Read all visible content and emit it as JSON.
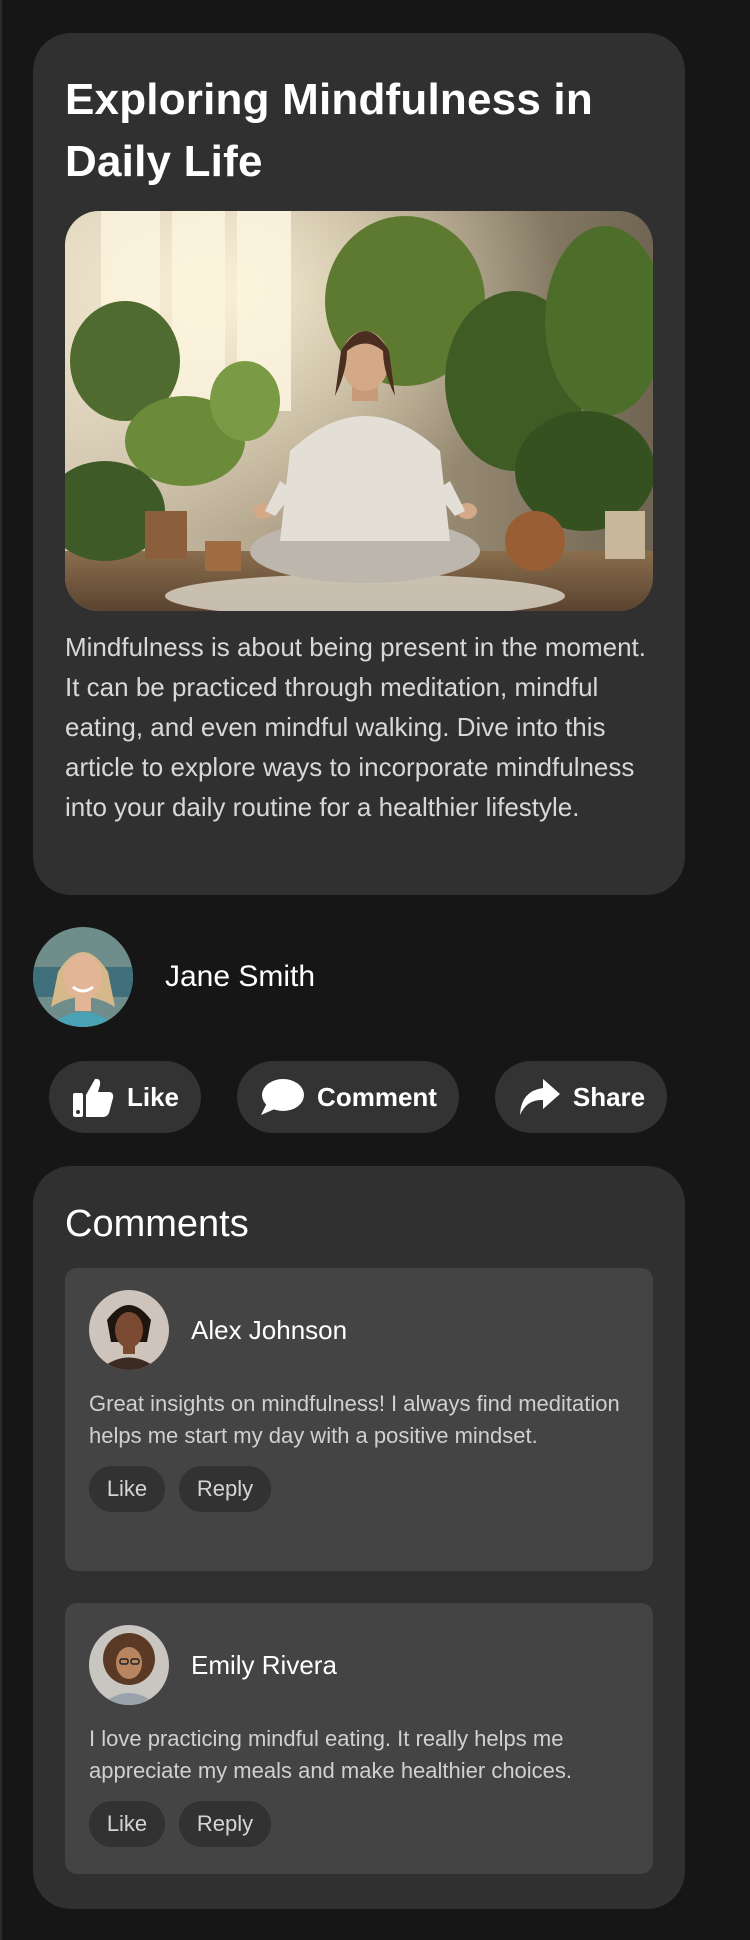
{
  "article": {
    "title": "Exploring Mindfulness in Daily Life",
    "image_alt": "Woman meditating among houseplants",
    "body": "Mindfulness is about being present in the moment. It can be practiced through meditation, mindful eating, and even mindful walking. Dive into this article to explore ways to incorporate mindfulness into your daily routine for a healthier lifestyle."
  },
  "author": {
    "name": "Jane Smith"
  },
  "actions": {
    "like": "Like",
    "comment": "Comment",
    "share": "Share"
  },
  "comments": {
    "title": "Comments",
    "items": [
      {
        "name": "Alex Johnson",
        "text": "Great insights on mindfulness! I always find meditation helps me start my day with a positive mindset.",
        "like": "Like",
        "reply": "Reply"
      },
      {
        "name": "Emily Rivera",
        "text": "I love practicing mindful eating. It really helps me appreciate my meals and make healthier choices.",
        "like": "Like",
        "reply": "Reply"
      }
    ]
  },
  "colors": {
    "background": "#161616",
    "card": "#303030",
    "comment_card": "#444444",
    "button": "#333333",
    "text": "#ffffff",
    "muted_text": "#d8d8d8"
  },
  "icons": [
    "thumbs-up-icon",
    "speech-bubble-icon",
    "share-arrow-icon"
  ]
}
